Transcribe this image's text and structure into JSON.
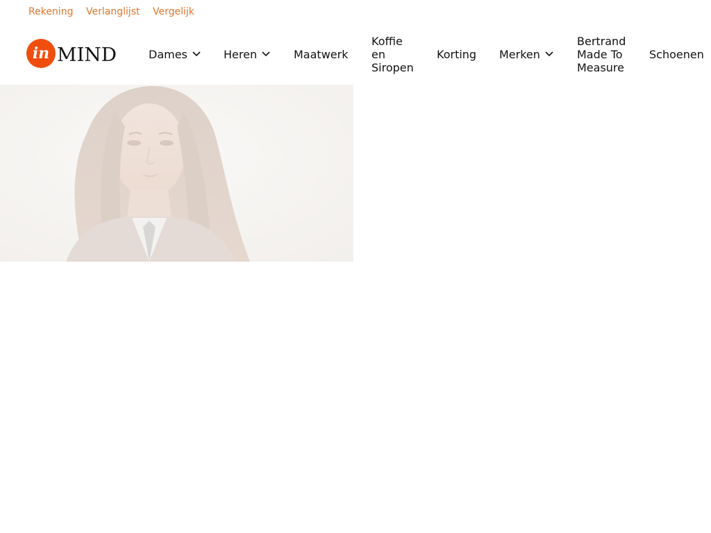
{
  "topbar": {
    "links": [
      {
        "label": "Rekening"
      },
      {
        "label": "Verlanglijst"
      },
      {
        "label": "Vergelijk"
      }
    ]
  },
  "header": {
    "logo": {
      "prefix": "in",
      "word": "MIND",
      "icon": "inmind-logo",
      "brand_color": "#f04e0f"
    },
    "nav": {
      "dames": {
        "label": "Dames",
        "icon": "chevron-down-icon"
      },
      "heren": {
        "label": "Heren",
        "icon": "chevron-down-icon"
      },
      "maatwerk": {
        "label": "Maatwerk"
      },
      "koffie": {
        "lines": [
          "Koffie",
          "en",
          "Siropen"
        ]
      },
      "korting": {
        "label": "Korting"
      },
      "merken": {
        "label": "Merken",
        "icon": "chevron-down-icon"
      },
      "bertrand": {
        "lines": [
          "Bertrand",
          "Made To",
          "Measure"
        ]
      },
      "schoenen": {
        "label": "Schoenen"
      }
    }
  },
  "colors": {
    "accent": "#e0762c",
    "text": "#111111",
    "background": "#ffffff"
  }
}
